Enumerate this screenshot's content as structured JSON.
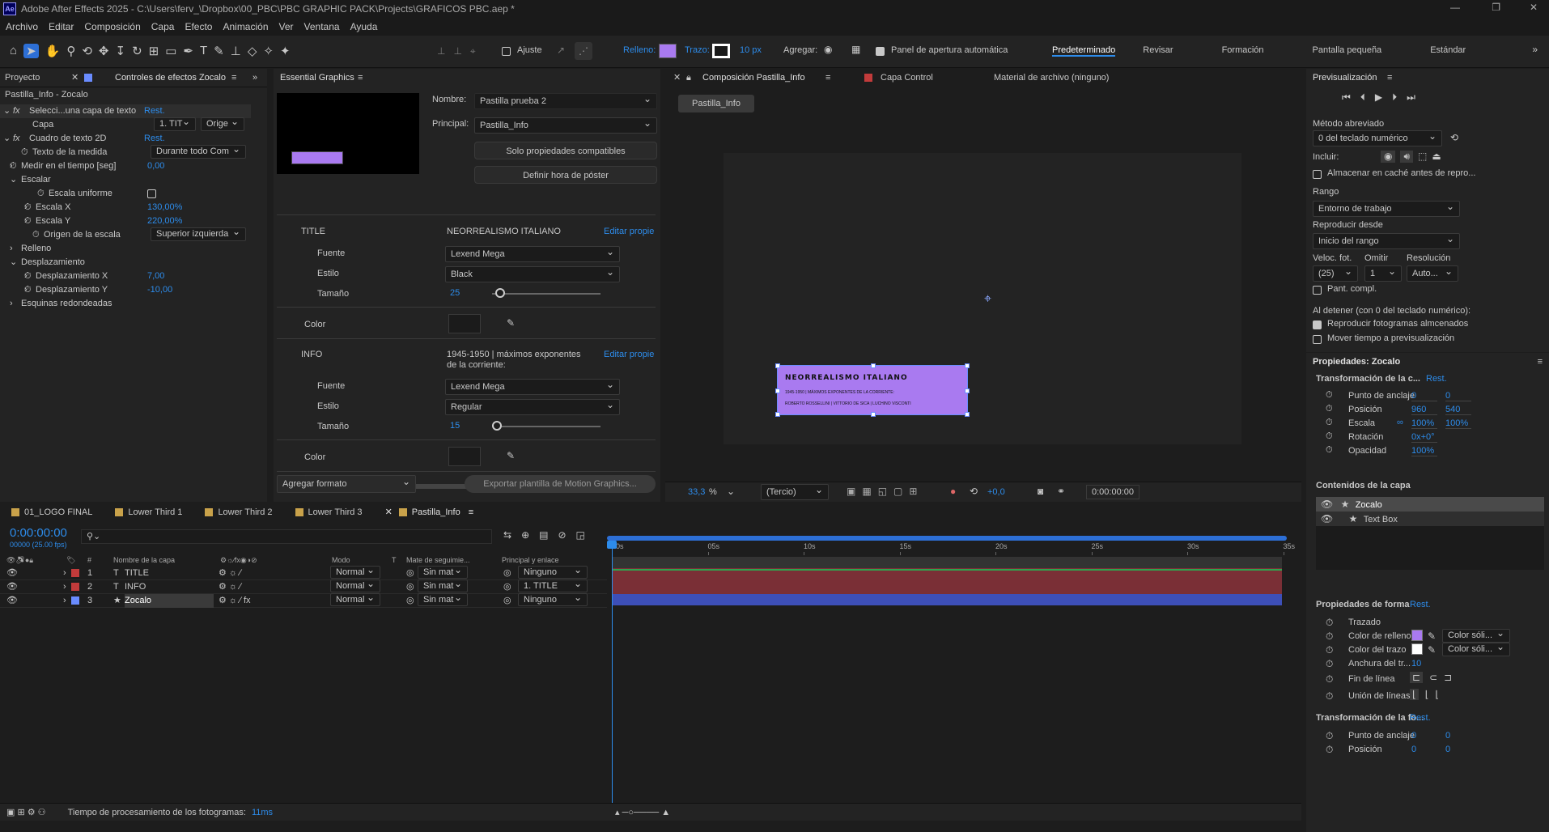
{
  "app": {
    "title": "Adobe After Effects 2025 - C:\\Users\\ferv_\\Dropbox\\00_PBC\\PBC GRAPHIC PACK\\Projects\\GRAFICOS PBC.aep *",
    "logo": "Ae"
  },
  "menu": [
    "Archivo",
    "Editar",
    "Composición",
    "Capa",
    "Efecto",
    "Animación",
    "Ver",
    "Ventana",
    "Ayuda"
  ],
  "toolbar": {
    "ajuste": "Ajuste",
    "relleno": "Relleno:",
    "trazo": "Trazo:",
    "trazo_px": "10 px",
    "agregar": "Agregar:",
    "panel_apertura": "Panel de apertura automática",
    "workspaces": [
      "Predeterminado",
      "Revisar",
      "Formación",
      "Pantalla pequeña",
      "Estándar"
    ],
    "fill_color": "#a97af0"
  },
  "left_panel": {
    "tab_proyecto": "Proyecto",
    "tab_controles": "Controles de efectos Zocalo",
    "layer": "Pastilla_Info - Zocalo",
    "rows": [
      {
        "label": "Selecci...una capa de texto",
        "value": "Rest."
      },
      {
        "label": "Capa",
        "value": "1. TIT",
        "extra": "Orige"
      },
      {
        "label": "Cuadro de texto 2D",
        "value": "Rest."
      },
      {
        "label": "Texto de la medida",
        "value": "Durante todo Com"
      },
      {
        "label": "Medir en el tiempo [seg]",
        "value": "0,00"
      },
      {
        "label": "Escalar",
        "value": ""
      },
      {
        "label": "Escala uniforme",
        "value": ""
      },
      {
        "label": "Escala X",
        "value": "130,00%"
      },
      {
        "label": "Escala Y",
        "value": "220,00%"
      },
      {
        "label": "Origen de la escala",
        "value": "Superior izquierda"
      },
      {
        "label": "Relleno",
        "value": ""
      },
      {
        "label": "Desplazamiento",
        "value": ""
      },
      {
        "label": "Desplazamiento X",
        "value": "7,00"
      },
      {
        "label": "Desplazamiento Y",
        "value": "-10,00"
      },
      {
        "label": "Esquinas redondeadas",
        "value": ""
      }
    ]
  },
  "eg": {
    "title": "Essential Graphics",
    "nombre_label": "Nombre:",
    "nombre": "Pastilla prueba 2",
    "principal_label": "Principal:",
    "principal": "Pastilla_Info",
    "solo": "Solo propiedades compatibles",
    "definir": "Definir hora de póster",
    "title_label": "TITLE",
    "title_text": "NEORREALISMO ITALIANO",
    "editar": "Editar propie",
    "fuente": "Fuente",
    "estilo": "Estilo",
    "tamano": "Tamaño",
    "color": "Color",
    "t_font": "Lexend Mega",
    "t_style": "Black",
    "t_size": "25",
    "info_label": "INFO",
    "info_text": "1945-1950 | máximos exponentes de la corriente:",
    "i_font": "Lexend Mega",
    "i_style": "Regular",
    "i_size": "15",
    "agregar_formato": "Agregar formato",
    "exportar": "Exportar plantilla de Motion Graphics..."
  },
  "comp": {
    "tab": "Composición Pastilla_Info",
    "capa": "Capa Control",
    "material": "Material de archivo (ninguno)",
    "crumb": "Pastilla_Info",
    "lt_title": "NEORREALISMO ITALIANO",
    "lt_line2": "1945-1950 | MÁXIMOS EXPONENTES DE LA CORRIENTE:",
    "lt_line3": "ROBERTO ROSSELLINI | VITTORIO DE SICA | LUCHINO VISCONTI",
    "zoom": "33,3",
    "pct": "%",
    "res": "(Tercio)",
    "exposure": "+0,0",
    "time": "0:00:00:00"
  },
  "preview": {
    "title": "Previsualización",
    "metodo": "Método abreviado",
    "metodo_val": "0 del teclado numérico",
    "incluir": "Incluir:",
    "cache": "Almacenar en caché antes de repro...",
    "rango": "Rango",
    "rango_val": "Entorno de trabajo",
    "repr": "Reproducir desde",
    "repr_val": "Inicio del rango",
    "veloc": "Veloc. fot.",
    "omitir": "Omitir",
    "resol": "Resolución",
    "veloc_val": "(25)",
    "omitir_val": "1",
    "resol_val": "Auto...",
    "pant": "Pant. compl.",
    "detener": "Al detener (con 0 del teclado numérico):",
    "repro_alm": "Reproducir fotogramas almcenados",
    "mover": "Mover tiempo a previsualización"
  },
  "props": {
    "title": "Propiedades: Zocalo",
    "trans": "Transformación de la c...",
    "rest": "Rest.",
    "anclaje": "Punto de anclaje",
    "anc_x": "0",
    "anc_y": "0",
    "posicion": "Posición",
    "pos_x": "960",
    "pos_y": "540",
    "escala": "Escala",
    "esc_x": "100%",
    "esc_y": "100%",
    "rotacion": "Rotación",
    "rot": "0x+0°",
    "opacidad": "Opacidad",
    "op": "100%",
    "contenidos": "Contenidos de la capa",
    "c1": "Zocalo",
    "c2": "Text Box",
    "forma": "Propiedades de forma",
    "trazado": "Trazado",
    "relleno": "Color de relleno",
    "trazo_c": "Color del trazo",
    "solido": "Color sóli...",
    "anchura": "Anchura del tr...",
    "anchura_v": "10",
    "fin": "Fin de línea",
    "union": "Unión de líneas",
    "trans2": "Transformación de la fo...",
    "anc2_x": "0",
    "anc2_y": "0",
    "pos2_x": "0",
    "pos2_y": "0"
  },
  "timeline": {
    "tabs": [
      "01_LOGO FINAL",
      "Lower Third 1",
      "Lower Third 2",
      "Lower Third 3",
      "Pastilla_Info"
    ],
    "time": "0:00:00:00",
    "fps": "00000 (25.00 fps)",
    "cols": {
      "nombre": "Nombre de la capa",
      "modo": "Modo",
      "t": "T",
      "mate": "Mate de seguimie...",
      "principal": "Principal y enlace"
    },
    "layers": [
      {
        "num": "1",
        "name": "TITLE",
        "type": "T",
        "color": "#c23b3b",
        "mode": "Normal",
        "mate": "Sin mat",
        "parent": "Ninguno"
      },
      {
        "num": "2",
        "name": "INFO",
        "type": "T",
        "color": "#c23b3b",
        "mode": "Normal",
        "mate": "Sin mat",
        "parent": "1. TITLE"
      },
      {
        "num": "3",
        "name": "Zocalo",
        "type": "★",
        "color": "#6a8cff",
        "mode": "Normal",
        "mate": "Sin mat",
        "parent": "Ninguno"
      }
    ],
    "ruler": [
      "00s",
      "05s",
      "10s",
      "15s",
      "20s",
      "25s",
      "30s",
      "35s"
    ],
    "footer": "Tiempo de procesamiento de los fotogramas:",
    "footer_val": "11ms"
  }
}
